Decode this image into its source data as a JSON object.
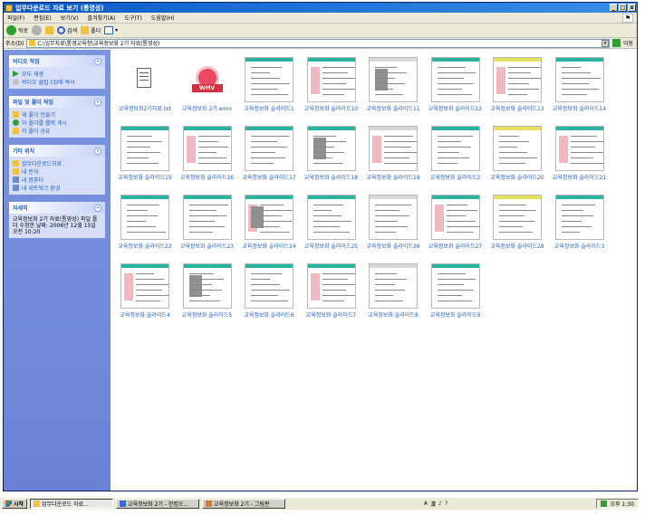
{
  "window": {
    "title": "업무다운로드 자료 보기 (통영성)",
    "controls": [
      "_",
      "□",
      "x"
    ]
  },
  "menu": [
    "파일(F)",
    "편집(E)",
    "보기(V)",
    "즐겨찾기(A)",
    "도구(T)",
    "도움말(H)"
  ],
  "toolbar": {
    "back_label": "뒤로",
    "search_label": "검색",
    "folders_label": "폴더"
  },
  "address": {
    "label": "주소(D)",
    "value": "C:\\업무자료\\통영교육청\\교육정보화 2기 자료(통영성)",
    "go_label": "이동"
  },
  "taskpane": {
    "panels": [
      {
        "title": "비디오 작업",
        "items": [
          "모두 재생",
          "비디오 클립 CD에 복사"
        ]
      },
      {
        "title": "파일 및 폴더 작업",
        "items": [
          "새 폴더 만들기",
          "이 폴더를 웹에 게시",
          "이 폴더 공유"
        ]
      },
      {
        "title": "기타 위치",
        "items": [
          "업무다운로드자료",
          "내 문서",
          "내 컴퓨터",
          "내 네트워크 환경"
        ]
      },
      {
        "title": "자세히",
        "text": "교육정보화 2기 자료(통영성) 파일 폴더 수정한 날짜: 2006년 12월 15일 오전 10:20"
      }
    ]
  },
  "files": [
    {
      "name": "교육정보화2기자료.txt",
      "kind": "doc"
    },
    {
      "name": "교육정보화 2기.wmv",
      "kind": "wmv"
    },
    {
      "name": "교육정보화 슬라이드1",
      "kind": "slide"
    },
    {
      "name": "교육정보화 슬라이드10",
      "kind": "slide"
    },
    {
      "name": "교육정보화 슬라이드11",
      "kind": "slide"
    },
    {
      "name": "교육정보화 슬라이드12",
      "kind": "slide"
    },
    {
      "name": "교육정보화 슬라이드13",
      "kind": "slide"
    },
    {
      "name": "교육정보화 슬라이드14",
      "kind": "slide"
    },
    {
      "name": "교육정보화 슬라이드15",
      "kind": "slide"
    },
    {
      "name": "교육정보화 슬라이드16",
      "kind": "slide"
    },
    {
      "name": "교육정보화 슬라이드17",
      "kind": "slide"
    },
    {
      "name": "교육정보화 슬라이드18",
      "kind": "slide"
    },
    {
      "name": "교육정보화 슬라이드19",
      "kind": "slide"
    },
    {
      "name": "교육정보화 슬라이드2",
      "kind": "slide"
    },
    {
      "name": "교육정보화 슬라이드20",
      "kind": "slide"
    },
    {
      "name": "교육정보화 슬라이드21",
      "kind": "slide"
    },
    {
      "name": "교육정보화 슬라이드22",
      "kind": "slide"
    },
    {
      "name": "교육정보화 슬라이드23",
      "kind": "slide"
    },
    {
      "name": "교육정보화 슬라이드24",
      "kind": "slide"
    },
    {
      "name": "교육정보화 슬라이드25",
      "kind": "slide"
    },
    {
      "name": "교육정보화 슬라이드26",
      "kind": "slide"
    },
    {
      "name": "교육정보화 슬라이드27",
      "kind": "slide"
    },
    {
      "name": "교육정보화 슬라이드28",
      "kind": "slide"
    },
    {
      "name": "교육정보화 슬라이드3",
      "kind": "slide"
    },
    {
      "name": "교육정보화 슬라이드4",
      "kind": "slide"
    },
    {
      "name": "교육정보화 슬라이드5",
      "kind": "slide"
    },
    {
      "name": "교육정보화 슬라이드6",
      "kind": "slide"
    },
    {
      "name": "교육정보화 슬라이드7",
      "kind": "slide"
    },
    {
      "name": "교육정보화 슬라이드8",
      "kind": "slide"
    },
    {
      "name": "교육정보화 슬라이드9",
      "kind": "slide"
    }
  ],
  "taskbar": {
    "start_label": "시작",
    "tasks": [
      "업무다운로드 자료...",
      "교육정보화 2기 - 한컴오...",
      "교육정보화 2기 - 그림판"
    ],
    "ime": [
      "A",
      "漢",
      "♪",
      "?"
    ],
    "clock": "오후 1:30"
  }
}
